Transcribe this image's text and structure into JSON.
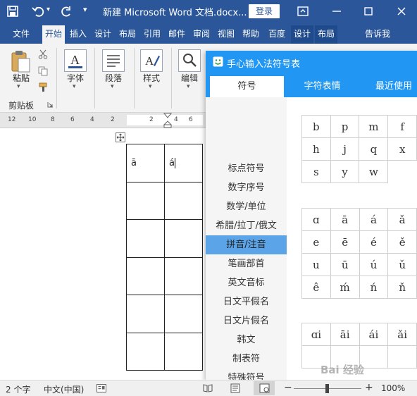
{
  "titlebar": {
    "title": "新建 Microsoft Word 文档.docx...",
    "login_label": "登录",
    "quick_access_more": "▾"
  },
  "tabs": [
    {
      "label": "文件"
    },
    {
      "label": "开始"
    },
    {
      "label": "插入"
    },
    {
      "label": "设计"
    },
    {
      "label": "布局"
    },
    {
      "label": "引用"
    },
    {
      "label": "邮件"
    },
    {
      "label": "审阅"
    },
    {
      "label": "视图"
    },
    {
      "label": "帮助"
    },
    {
      "label": "百度"
    },
    {
      "label": "设计"
    },
    {
      "label": "布局"
    },
    {
      "label": "告诉我"
    }
  ],
  "ribbon": {
    "paste_label": "粘贴",
    "clipboard_label": "剪贴板",
    "font_label": "字体",
    "paragraph_label": "段落",
    "styles_label": "样式",
    "edit_label": "编辑",
    "dropdown": "▾"
  },
  "ruler": {
    "labels": [
      "12",
      "10",
      "8",
      "6",
      "4",
      "2",
      "2",
      "4",
      "6"
    ]
  },
  "document": {
    "table": [
      [
        "ā",
        "á"
      ],
      [
        "",
        ""
      ],
      [
        "",
        ""
      ],
      [
        "",
        ""
      ],
      [
        "",
        ""
      ],
      [
        "",
        ""
      ],
      [
        "",
        ""
      ]
    ]
  },
  "symbol_panel": {
    "title": "手心输入法符号表",
    "tabs": [
      {
        "label": "符号"
      },
      {
        "label": "字符表情"
      },
      {
        "label": "最近使用"
      }
    ],
    "active_tab": 0,
    "categories": [
      {
        "label": "标点符号"
      },
      {
        "label": "数字序号"
      },
      {
        "label": "数学/单位"
      },
      {
        "label": "希腊/拉丁/俄文"
      },
      {
        "label": "拼音/注音"
      },
      {
        "label": "笔画部首"
      },
      {
        "label": "英文音标"
      },
      {
        "label": "日文平假名"
      },
      {
        "label": "日文片假名"
      },
      {
        "label": "韩文"
      },
      {
        "label": "制表符"
      },
      {
        "label": "特殊符号"
      }
    ],
    "selected_category": 4,
    "grid_consonants": [
      [
        "b",
        "p",
        "m",
        "f"
      ],
      [
        "h",
        "j",
        "q",
        "x"
      ],
      [
        "s",
        "y",
        "w",
        ""
      ]
    ],
    "grid_vowels": [
      [
        "ɑ",
        "ā",
        "á",
        "ǎ"
      ],
      [
        "e",
        "ē",
        "é",
        "ě"
      ],
      [
        "u",
        "ū",
        "ú",
        "ǔ"
      ],
      [
        "ê",
        "ḿ",
        "ń",
        "ň"
      ]
    ],
    "grid_finals": [
      [
        "ɑi",
        "āi",
        "ái",
        "ǎi"
      ]
    ]
  },
  "statusbar": {
    "word_count": "2 个字",
    "language": "中文(中国)",
    "zoom_minus": "−",
    "zoom_plus": "+",
    "zoom": "100%",
    "zoom_level_percent": 100
  },
  "watermark": "Bai 经验"
}
